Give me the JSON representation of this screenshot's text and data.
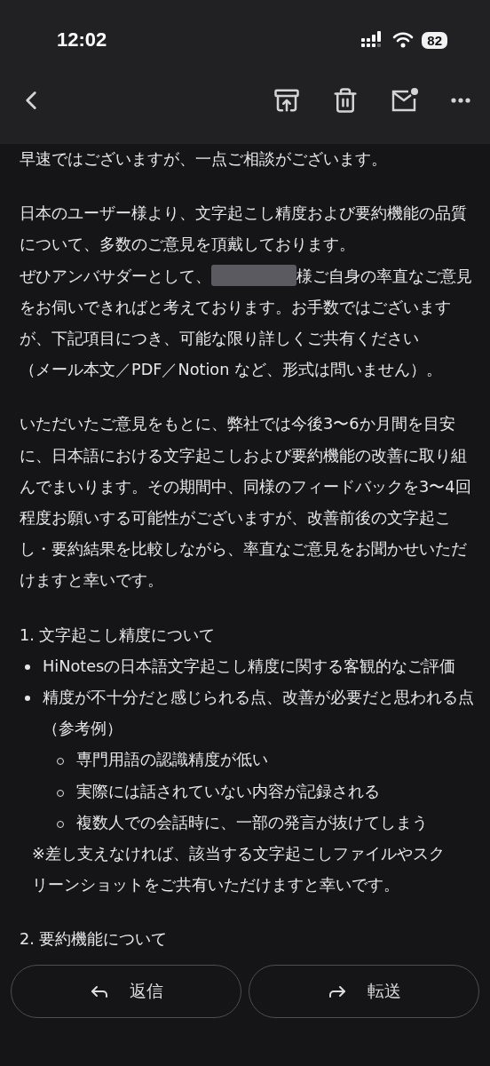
{
  "status_bar": {
    "time": "12:02",
    "battery": "82"
  },
  "body": [
    {
      "kind": "paragraph",
      "text": "早速ではございますが、一点ご相談がございます。"
    },
    {
      "kind": "paragraph",
      "text": "日本のユーザー様より、文字起こし精度および要約機能の品質について、多数のご意見を頂戴しております。"
    },
    {
      "kind": "redacted",
      "before": "ぜひアンバサダーとして、",
      "after": "様ご自身の率直なご意見をお伺いできればと考えております。お手数ではございますが、下記項目につき、可能な限り詳しくご共有ください"
    },
    {
      "kind": "continuation",
      "text": "（メール本文／PDF／Notion など、形式は問いません）。"
    },
    {
      "kind": "paragraph",
      "text": "いただいたご意見をもとに、弊社では今後3〜6か月間を目安に、日本語における文字起こしおよび要約機能の改善に取り組んでまいります。その期間中、同様のフィードバックを3〜4回程度お願いする可能性がございますが、改善前後の文字起こし・要約結果を比較しながら、率直なご意見をお聞かせいただけますと幸いです。"
    },
    {
      "kind": "heading",
      "text": "1. 文字起こし精度について"
    },
    {
      "kind": "list",
      "items": [
        {
          "text": "HiNotesの日本語文字起こし精度に関する客観的なご評価"
        },
        {
          "text": "精度が不十分だと感じられる点、改善が必要だと思われる点（参考例）",
          "children": [
            {
              "text": "専門用語の認識精度が低い"
            },
            {
              "text": "実際には話されていない内容が記録される"
            },
            {
              "text": "複数人での会話時に、一部の発言が抜けてしまう"
            }
          ]
        }
      ]
    },
    {
      "kind": "note",
      "text": "※差し支えなければ、該当する文字起こしファイルやスクリーンショットをご共有いただけますと幸いです。"
    },
    {
      "kind": "heading",
      "text": "2. 要約機能について"
    }
  ],
  "actions": [
    {
      "kind": "reply",
      "label": "返信"
    },
    {
      "kind": "forward",
      "label": "転送"
    }
  ]
}
